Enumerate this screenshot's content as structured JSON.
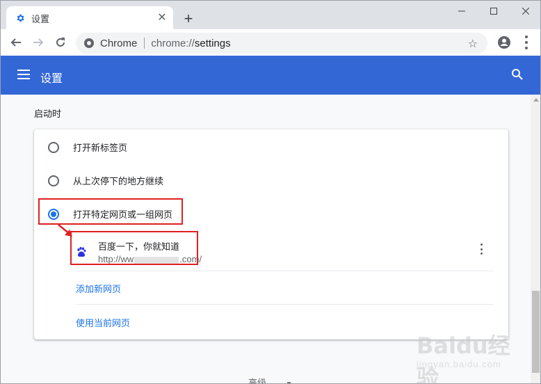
{
  "tab": {
    "title": "设置"
  },
  "toolbar": {
    "site_chip": "Chrome",
    "url_scheme": "chrome://",
    "url_path": "settings"
  },
  "header": {
    "title": "设置"
  },
  "startup": {
    "section_title": "启动时",
    "options": [
      {
        "label": "打开新标签页",
        "checked": false
      },
      {
        "label": "从上次停下的地方继续",
        "checked": false
      },
      {
        "label": "打开特定网页或一组网页",
        "checked": true
      }
    ],
    "page": {
      "name": "百度一下，你就知道",
      "url_prefix": "http://ww",
      "url_suffix": ".com/"
    },
    "add_page": "添加新网页",
    "use_current": "使用当前网页"
  },
  "advanced_label": "高级",
  "watermark": {
    "brand": "Baidu经验",
    "sub": "jingyan.baidu.com"
  },
  "colors": {
    "header_bg": "#3367d6",
    "accent": "#1a73e8",
    "highlight": "#e02020"
  },
  "icons": [
    "settings-gear-icon",
    "close-icon",
    "plus-icon",
    "minimize-icon",
    "maximize-icon",
    "close-window-icon",
    "back-arrow-icon",
    "forward-arrow-icon",
    "reload-icon",
    "chrome-site-icon",
    "star-icon",
    "profile-icon",
    "more-vert-icon",
    "hamburger-icon",
    "search-icon",
    "baidu-paw-icon"
  ]
}
